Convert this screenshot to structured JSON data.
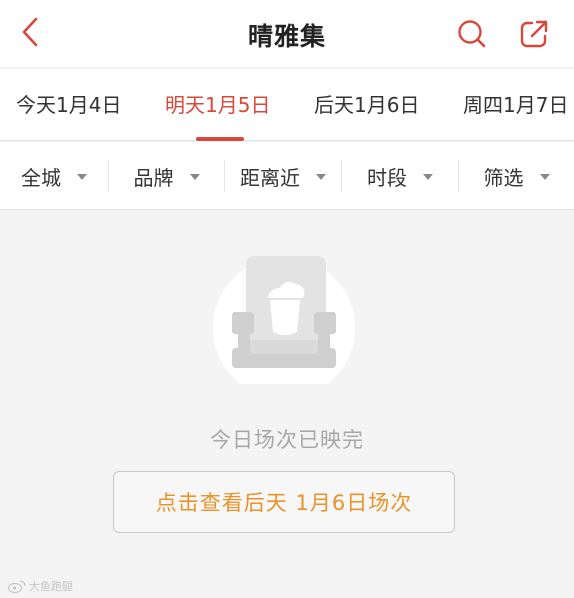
{
  "header": {
    "title": "晴雅集",
    "back_icon": "chevron-left-icon",
    "search_icon": "search-icon",
    "share_icon": "share-icon",
    "accent_color": "#d9473a"
  },
  "date_tabs": [
    {
      "label": "今天1月4日",
      "active": false
    },
    {
      "label": "明天1月5日",
      "active": true
    },
    {
      "label": "后天1月6日",
      "active": false
    },
    {
      "label": "周四1月7日",
      "active": false
    }
  ],
  "filters": [
    {
      "label": "全城"
    },
    {
      "label": "品牌"
    },
    {
      "label": "距离近"
    },
    {
      "label": "时段"
    },
    {
      "label": "筛选"
    }
  ],
  "empty_state": {
    "illustration_icon": "cinema-seat-icon",
    "message": "今日场次已映完",
    "action_label": "点击查看后天 1月6日场次",
    "action_color": "#e9932a"
  },
  "watermark": {
    "text": "大鱼跑腿"
  }
}
